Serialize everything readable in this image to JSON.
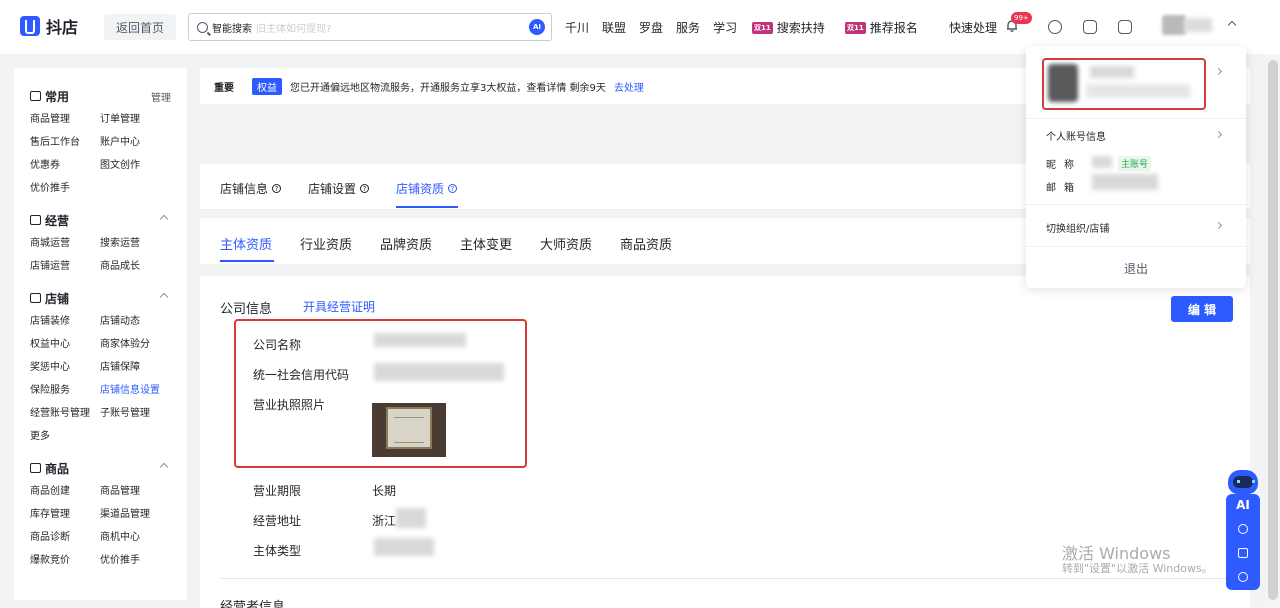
{
  "topbar": {
    "logo": "抖店",
    "home_label": "返回首页",
    "search_label": "智能搜索",
    "search_placeholder": "旧主体如何提现?",
    "search_ai": "AI",
    "nav": [
      "千川",
      "联盟",
      "罗盘",
      "服务",
      "学习"
    ],
    "promo_badge": "双11",
    "promo_items": [
      "搜索扶持",
      "推荐报名"
    ],
    "quick_handle": "快速处理",
    "notification_count": "99+"
  },
  "sidebar": {
    "sections": [
      {
        "title": "常用",
        "right": "管理",
        "items": [
          "商品管理",
          "订单管理",
          "售后工作台",
          "账户中心",
          "优惠券",
          "图文创作",
          "优价推手"
        ]
      },
      {
        "title": "经营",
        "items": [
          "商城运营",
          "搜索运营",
          "店铺运营",
          "商品成长"
        ]
      },
      {
        "title": "店铺",
        "items": [
          "店铺装修",
          "店铺动态",
          "权益中心",
          "商家体验分",
          "奖惩中心",
          "店铺保障",
          "保险服务",
          "店铺信息设置",
          "经营账号管理",
          "子账号管理",
          "更多"
        ],
        "active": "店铺信息设置"
      },
      {
        "title": "商品",
        "items": [
          "商品创建",
          "商品管理",
          "库存管理",
          "渠道品管理",
          "商品诊断",
          "商机中心",
          "爆款竞价",
          "优价推手"
        ]
      }
    ]
  },
  "notice": {
    "label": "重要",
    "tag": "权益",
    "message": "您已开通偏远地区物流服务，开通服务立享3大权益，查看详情 剩余9天",
    "link": "去处理"
  },
  "tabs1": {
    "items": [
      "店铺信息",
      "店铺设置",
      "店铺资质"
    ],
    "active": "店铺资质",
    "help_icon": "?"
  },
  "tabs2": {
    "items": [
      "主体资质",
      "行业资质",
      "品牌资质",
      "主体变更",
      "大师资质",
      "商品资质"
    ],
    "active": "主体资质"
  },
  "company": {
    "section_title": "公司信息",
    "cert_link": "开具经营证明",
    "edit_label": "编 辑",
    "fields": {
      "name_label": "公司名称",
      "credit_code_label": "统一社会信用代码",
      "license_photo_label": "营业执照照片",
      "period_label": "营业期限",
      "period_value": "长期",
      "address_label": "经营地址",
      "address_value": "浙江",
      "type_label": "主体类型"
    },
    "next_section_title": "经营者信息"
  },
  "account_menu": {
    "personal_info": "个人账号信息",
    "nickname_label": "昵称",
    "main_account_tag": "主账号",
    "email_label": "邮箱",
    "switch_org": "切换组织/店铺",
    "logout": "退出"
  },
  "float": {
    "ai": "AI"
  },
  "watermark": {
    "line1": "激活 Windows",
    "line2": "转到\"设置\"以激活 Windows。"
  },
  "colors": {
    "accent": "#2d5bff",
    "highlight_box": "#d43c3c",
    "promo": "#c0327a",
    "badge": "#e8344e"
  }
}
